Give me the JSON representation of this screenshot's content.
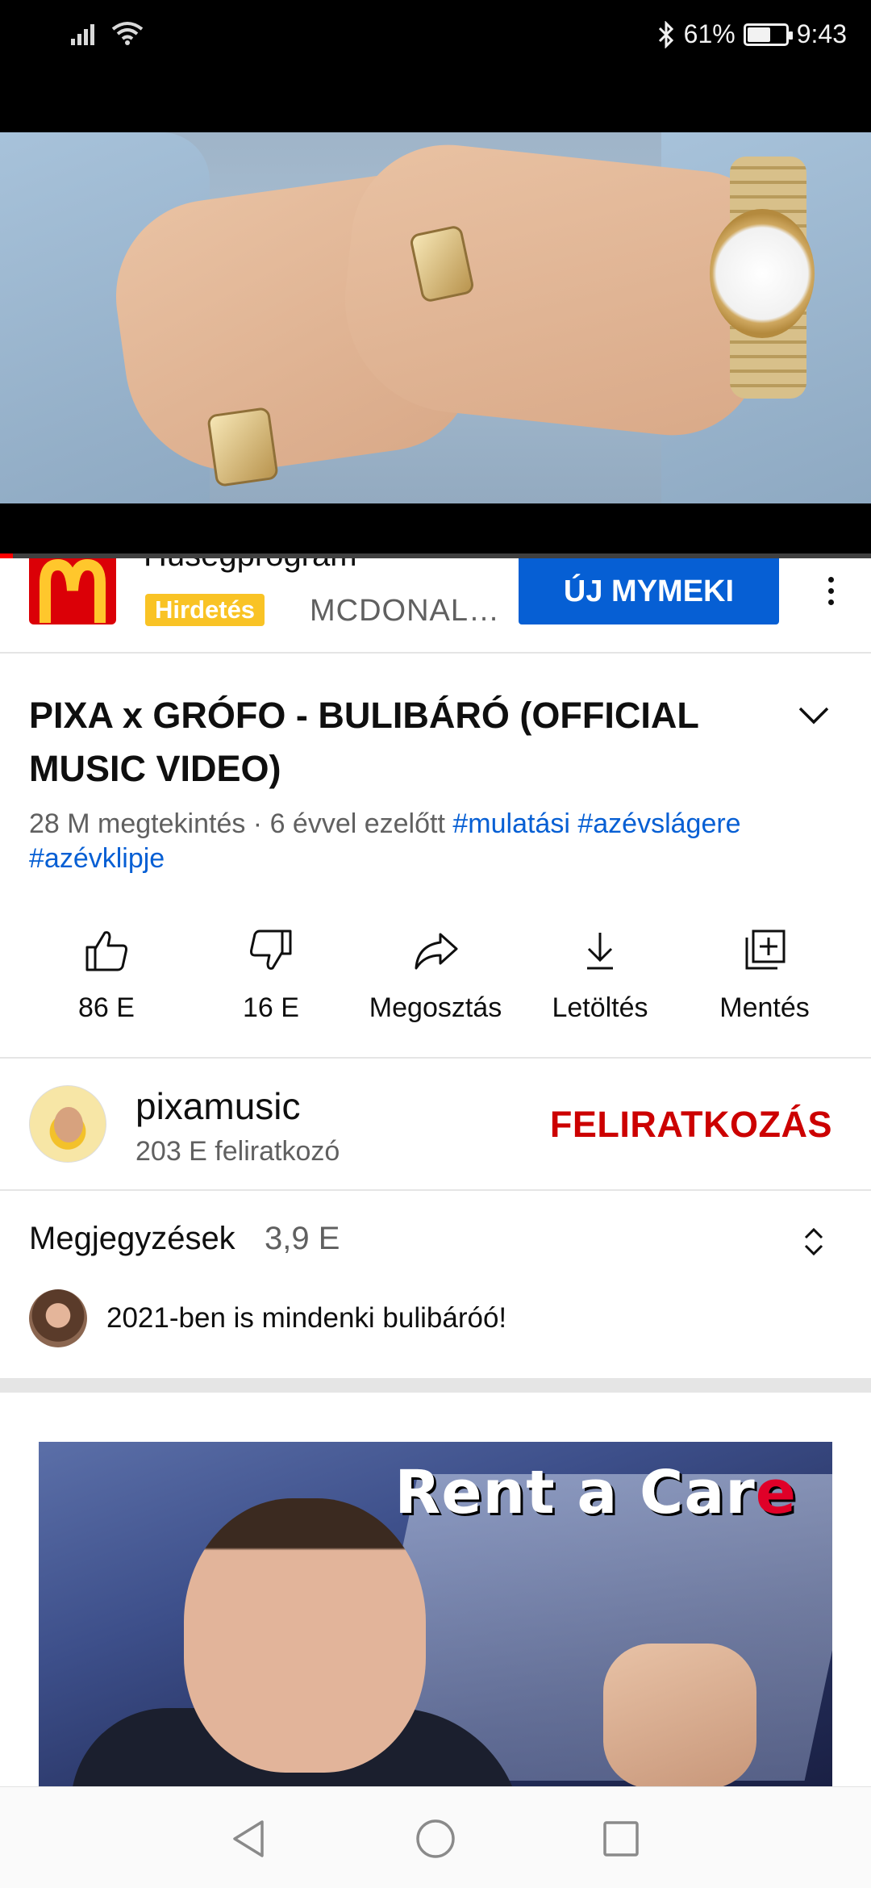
{
  "status_bar": {
    "battery_percent": "61%",
    "battery_level": 0.61,
    "time": "9:43",
    "icons": [
      "signal-icon",
      "wifi-icon",
      "bluetooth-icon",
      "battery-icon"
    ]
  },
  "player": {
    "progress_fraction": 0.015,
    "accent_color": "#ff0000"
  },
  "ad": {
    "title": "Hűségprogram",
    "badge": "Hirdetés",
    "advertiser": "MCDONAL…",
    "cta": "ÚJ MYMEKI",
    "badge_color": "#f9c325",
    "cta_color": "#065fd4"
  },
  "video": {
    "title": "PIXA x GRÓFO - BULIBÁRÓ (OFFICIAL MUSIC VIDEO)",
    "views_age": "28 M megtekintés · 6 évvel ezelőtt",
    "hashtags": [
      "#mulatási",
      "#azévslágere",
      "#azévklipje"
    ]
  },
  "actions": [
    {
      "icon": "thumbs-up-icon",
      "label": "86 E"
    },
    {
      "icon": "thumbs-down-icon",
      "label": "16 E"
    },
    {
      "icon": "share-icon",
      "label": "Megosztás"
    },
    {
      "icon": "download-icon",
      "label": "Letöltés"
    },
    {
      "icon": "save-playlist-icon",
      "label": "Mentés"
    }
  ],
  "channel": {
    "name": "pixamusic",
    "subscribers": "203 E feliratkozó",
    "subscribe_label": "FELIRATKOZÁS",
    "subscribe_color": "#cc0000"
  },
  "comments": {
    "header": "Megjegyzések",
    "count": "3,9 E",
    "top_comment": "2021-ben is mindenki bulibáróó!"
  },
  "next_video": {
    "thumbnail_text_main": "Rent a Car",
    "thumbnail_text_accent": "e"
  },
  "navbar": {
    "icons": [
      "back-icon",
      "home-icon",
      "recents-icon"
    ]
  }
}
